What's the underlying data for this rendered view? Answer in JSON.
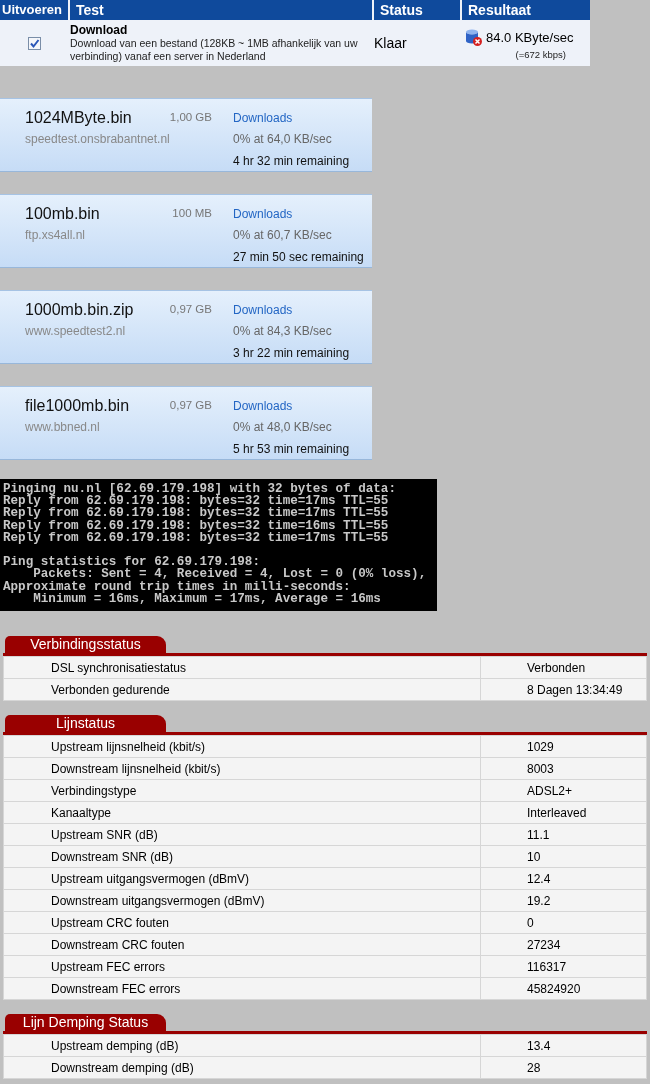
{
  "speedtest": {
    "columns": [
      "Uitvoeren",
      "Test",
      "Status",
      "Resultaat"
    ],
    "rows": [
      {
        "checked": true,
        "title": "Download",
        "description": "Download van een bestand (128KB ~ 1MB afhankelijk van uw verbinding) vanaf een server in Nederland",
        "status": "Klaar",
        "result": "84.0 KByte/sec",
        "result_note": "(=672 kbps)"
      }
    ]
  },
  "downloads": [
    {
      "filename": "1024MByte.bin",
      "size": "1,00 GB",
      "link": "Downloads",
      "host": "speedtest.onsbrabantnet.nl",
      "progress": "0% at 64,0 KB/sec",
      "remaining": "4 hr 32 min remaining"
    },
    {
      "filename": "100mb.bin",
      "size": "100 MB",
      "link": "Downloads",
      "host": "ftp.xs4all.nl",
      "progress": "0% at 60,7 KB/sec",
      "remaining": "27 min 50 sec remaining"
    },
    {
      "filename": "1000mb.bin.zip",
      "size": "0,97 GB",
      "link": "Downloads",
      "host": "www.speedtest2.nl",
      "progress": "0% at 84,3 KB/sec",
      "remaining": "3 hr 22 min remaining"
    },
    {
      "filename": "file1000mb.bin",
      "size": "0,97 GB",
      "link": "Downloads",
      "host": "www.bbned.nl",
      "progress": "0% at 48,0 KB/sec",
      "remaining": "5 hr 53 min remaining"
    }
  ],
  "console": {
    "blocks": [
      [
        "Pinging nu.nl [62.69.179.198] with 32 bytes of data:",
        "Reply from 62.69.179.198: bytes=32 time=17ms TTL=55",
        "Reply from 62.69.179.198: bytes=32 time=17ms TTL=55",
        "Reply from 62.69.179.198: bytes=32 time=16ms TTL=55",
        "Reply from 62.69.179.198: bytes=32 time=17ms TTL=55"
      ],
      [
        "Ping statistics for 62.69.179.198:",
        "    Packets: Sent = 4, Received = 4, Lost = 0 (0% loss),",
        "Approximate round trip times in milli-seconds:",
        "    Minimum = 16ms, Maximum = 17ms, Average = 16ms"
      ]
    ]
  },
  "panels": [
    {
      "title": "Verbindingsstatus",
      "rows": [
        {
          "label": "DSL synchronisatiestatus",
          "value": "Verbonden"
        },
        {
          "label": "Verbonden gedurende",
          "value": "8 Dagen 13:34:49"
        }
      ]
    },
    {
      "title": "Lijnstatus",
      "rows": [
        {
          "label": "Upstream lijnsnelheid (kbit/s)",
          "value": "1029"
        },
        {
          "label": "Downstream lijnsnelheid (kbit/s)",
          "value": "8003"
        },
        {
          "label": "Verbindingstype",
          "value": "ADSL2+"
        },
        {
          "label": "Kanaaltype",
          "value": "Interleaved"
        },
        {
          "label": "Upstream SNR (dB)",
          "value": "11.1"
        },
        {
          "label": "Downstream SNR (dB)",
          "value": "10"
        },
        {
          "label": "Upstream uitgangsvermogen (dBmV)",
          "value": "12.4"
        },
        {
          "label": "Downstream uitgangsvermogen (dBmV)",
          "value": "19.2"
        },
        {
          "label": "Upstream CRC fouten",
          "value": "0"
        },
        {
          "label": "Downstream CRC fouten",
          "value": "27234"
        },
        {
          "label": "Upstream FEC errors",
          "value": "116317"
        },
        {
          "label": "Downstream FEC errors",
          "value": "45824920"
        }
      ]
    },
    {
      "title": "Lijn Demping Status",
      "rows": [
        {
          "label": "Upstream demping (dB)",
          "value": "13.4"
        },
        {
          "label": "Downstream demping (dB)",
          "value": "28"
        }
      ]
    }
  ]
}
